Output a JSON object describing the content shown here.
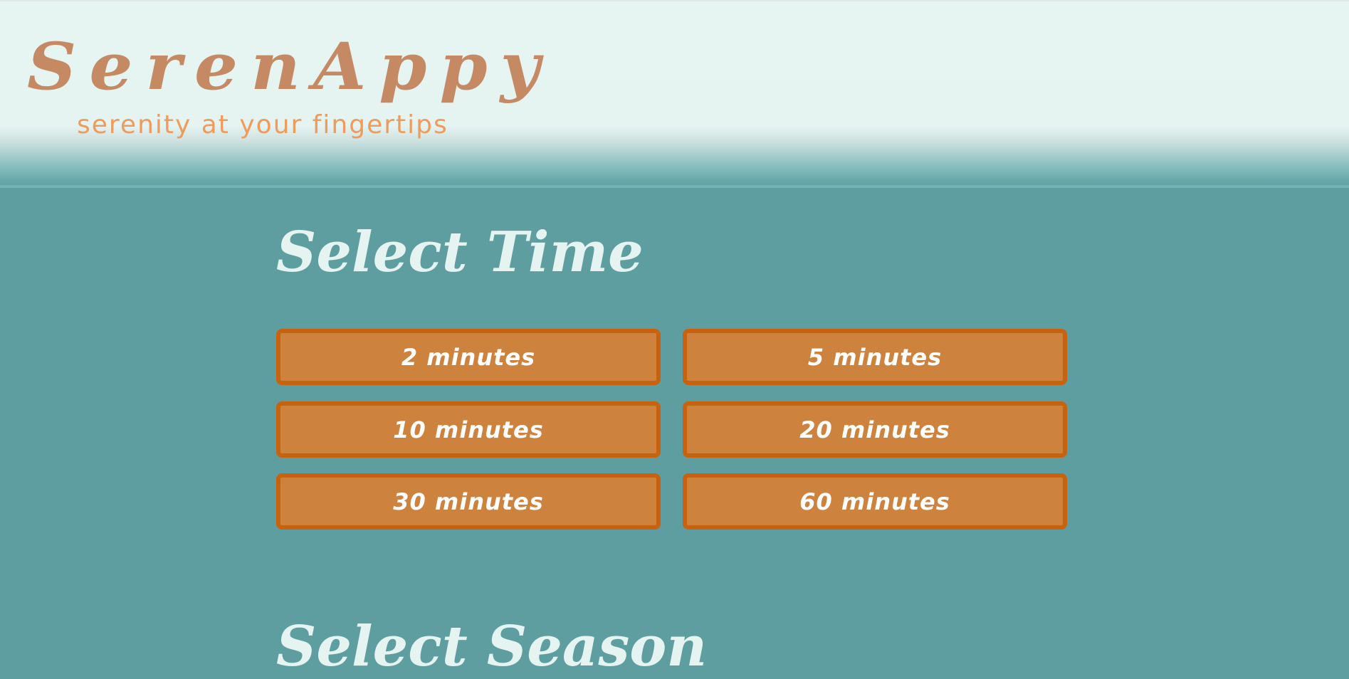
{
  "header": {
    "logo": "SerenAppy",
    "tagline": "serenity at your fingertips"
  },
  "time_section": {
    "title": "Select Time",
    "options": [
      {
        "label": "2 minutes"
      },
      {
        "label": "5 minutes"
      },
      {
        "label": "10 minutes"
      },
      {
        "label": "20 minutes"
      },
      {
        "label": "30 minutes"
      },
      {
        "label": "60 minutes"
      }
    ]
  },
  "season_section": {
    "title": "Select Season"
  },
  "colors": {
    "background": "#5f9ea0",
    "header_background": "#e7f5f2",
    "logo": "#c58a64",
    "tagline": "#ef9b5b",
    "button_fill": "#cd833e",
    "button_border": "#c8620f",
    "heading": "#e5f3f1"
  }
}
